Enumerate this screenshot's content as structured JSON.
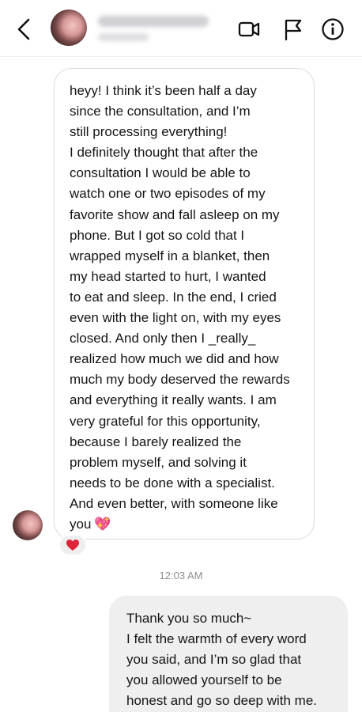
{
  "header": {
    "back_icon": "chevron-left-icon",
    "video_icon": "video-camera-icon",
    "flag_icon": "flag-icon",
    "info_icon": "info-icon"
  },
  "messages": {
    "incoming": {
      "lines": [
        "heyy! I think it’s been half a day",
        "since the consultation, and I’m",
        "still processing everything!",
        "I definitely thought that after the",
        "consultation I would be able to",
        "watch one or two episodes of my",
        "favorite show and fall asleep on my",
        "phone. But I got so cold that I",
        "wrapped myself in a blanket, then",
        "my head started to hurt, I wanted",
        "to eat and sleep. In the end, I cried",
        "even with the light on, with my eyes",
        "closed. And only then I _really_",
        "realized how much we did and how",
        "much my body deserved the rewards",
        "and everything it really wants. I am",
        "very grateful for this opportunity,",
        "because I barely realized the",
        "problem myself, and solving it",
        "needs to be done with a specialist.",
        "And even better, with someone like",
        "you"
      ],
      "trailing_emoji": "💖",
      "reaction": "❤"
    },
    "timestamp": "12:03 AM",
    "outgoing": {
      "lines": [
        "Thank you so much~",
        "I felt the warmth of every word",
        "you said, and I’m so glad that",
        "you allowed yourself to be",
        "honest and go so deep with me."
      ]
    }
  },
  "colors": {
    "reaction_heart": "#e0243a",
    "sparkle_heart": "#e0479e",
    "outgoing_bubble": "#efefef",
    "incoming_border": "#dcdcdc"
  }
}
